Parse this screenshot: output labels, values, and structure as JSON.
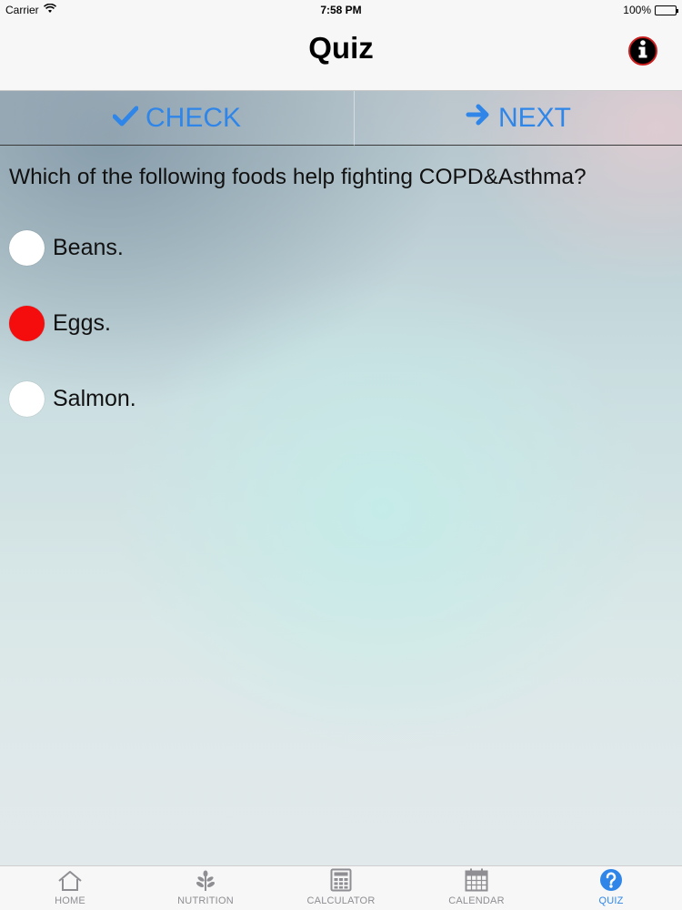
{
  "status_bar": {
    "carrier": "Carrier",
    "time": "7:58 PM",
    "battery": "100%",
    "battery_level": 1.0
  },
  "nav": {
    "title": "Quiz",
    "info_icon": "info-icon"
  },
  "actions": {
    "check_label": "CHECK",
    "next_label": "NEXT",
    "accent_color": "#2f86e8"
  },
  "quiz": {
    "question": "Which of the following foods help fighting COPD&Asthma?",
    "options": [
      {
        "label": "Beans.",
        "selected": false
      },
      {
        "label": "Eggs.",
        "selected": true
      },
      {
        "label": "Salmon.",
        "selected": false
      }
    ],
    "selected_color": "#f50d0d"
  },
  "tabs": [
    {
      "label": "HOME",
      "icon": "home-icon",
      "active": false
    },
    {
      "label": "NUTRITION",
      "icon": "plant-icon",
      "active": false
    },
    {
      "label": "CALCULATOR",
      "icon": "calculator-icon",
      "active": false
    },
    {
      "label": "CALENDAR",
      "icon": "calendar-icon",
      "active": false
    },
    {
      "label": "QUIZ",
      "icon": "question-icon",
      "active": true
    }
  ]
}
